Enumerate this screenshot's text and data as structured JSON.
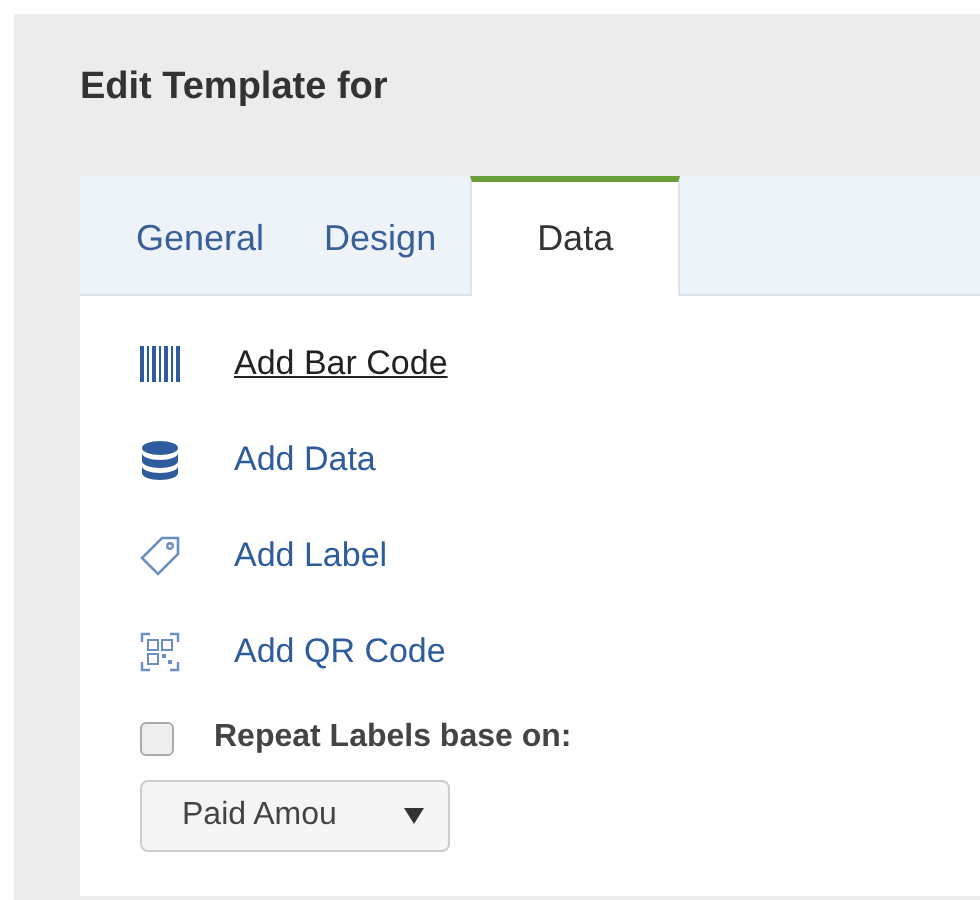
{
  "title": "Edit Template for",
  "tabs": [
    {
      "label": "General",
      "selected": false
    },
    {
      "label": "Design",
      "selected": false
    },
    {
      "label": "Data",
      "selected": true
    }
  ],
  "actions": [
    {
      "kind": "barcode",
      "label": "Add Bar Code",
      "hovered": true
    },
    {
      "kind": "database",
      "label": "Add Data",
      "hovered": false
    },
    {
      "kind": "tag",
      "label": "Add Label",
      "hovered": false
    },
    {
      "kind": "qrcode",
      "label": "Add QR Code",
      "hovered": false
    }
  ],
  "repeat": {
    "label": "Repeat Labels base on:",
    "checked": false
  },
  "dropdown": {
    "value": "Paid Amou"
  }
}
